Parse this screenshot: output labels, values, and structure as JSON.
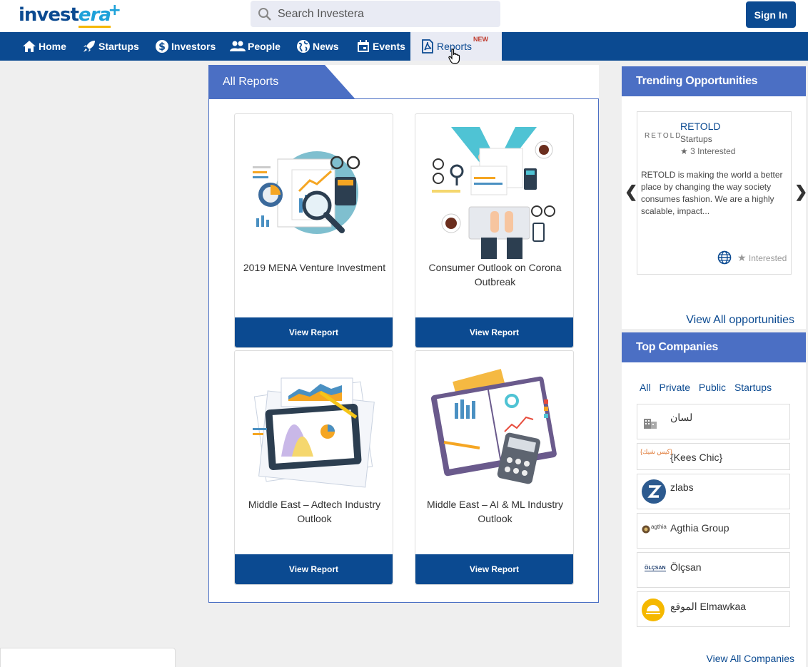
{
  "header": {
    "logo_part1": "invest",
    "logo_part2": "era",
    "logo_plus": "+",
    "search_placeholder": "Search Investera",
    "signin_label": "Sign In"
  },
  "nav": {
    "items": [
      {
        "label": "Home",
        "icon": "home-icon"
      },
      {
        "label": "Startups",
        "icon": "rocket-icon"
      },
      {
        "label": "Investors",
        "icon": "dollar-icon"
      },
      {
        "label": "People",
        "icon": "people-icon"
      },
      {
        "label": "News",
        "icon": "globe-icon"
      },
      {
        "label": "Events",
        "icon": "calendar-icon"
      },
      {
        "label": "Reports",
        "icon": "pdf-icon",
        "badge": "NEW"
      }
    ]
  },
  "main": {
    "tab_title": "All Reports",
    "cards": [
      {
        "title": "2019 MENA Venture Investment",
        "button": "View Report"
      },
      {
        "title": "Consumer Outlook on Corona Outbreak",
        "button": "View Report"
      },
      {
        "title": "Middle East – Adtech Industry Outlook",
        "button": "View Report"
      },
      {
        "title": "Middle East – AI & ML Industry Outlook",
        "button": "View Report"
      }
    ]
  },
  "trending": {
    "title": "Trending Opportunities",
    "logo_text": "RETOLD",
    "name": "RETOLD",
    "type": "Startups",
    "interested_count": "★ 3 Interested",
    "description": "RETOLD is making the world a better place by changing the way society consumes fashion. We are a highly scalable, impact...",
    "interested_button": "Interested",
    "prev": "❮",
    "next": "❯",
    "view_all": "View All opportunities"
  },
  "companies": {
    "title": "Top Companies",
    "filters": [
      "All",
      "Private",
      "Public",
      "Startups"
    ],
    "list": [
      {
        "name": "لسان"
      },
      {
        "name": "{Kees Chic}",
        "logo_text": "{كيس شيك}"
      },
      {
        "name": "zlabs"
      },
      {
        "name": "Agthia Group",
        "logo_text": "agthia"
      },
      {
        "name": "Ölçsan",
        "logo_text": "ÖLÇSAN"
      },
      {
        "name": "الموقع Elmawkaa"
      }
    ],
    "view_all": "View All Companies"
  },
  "colors": {
    "primary": "#0b4a91",
    "accent": "#4b6fc4",
    "search_bg": "#e9ebf4"
  }
}
